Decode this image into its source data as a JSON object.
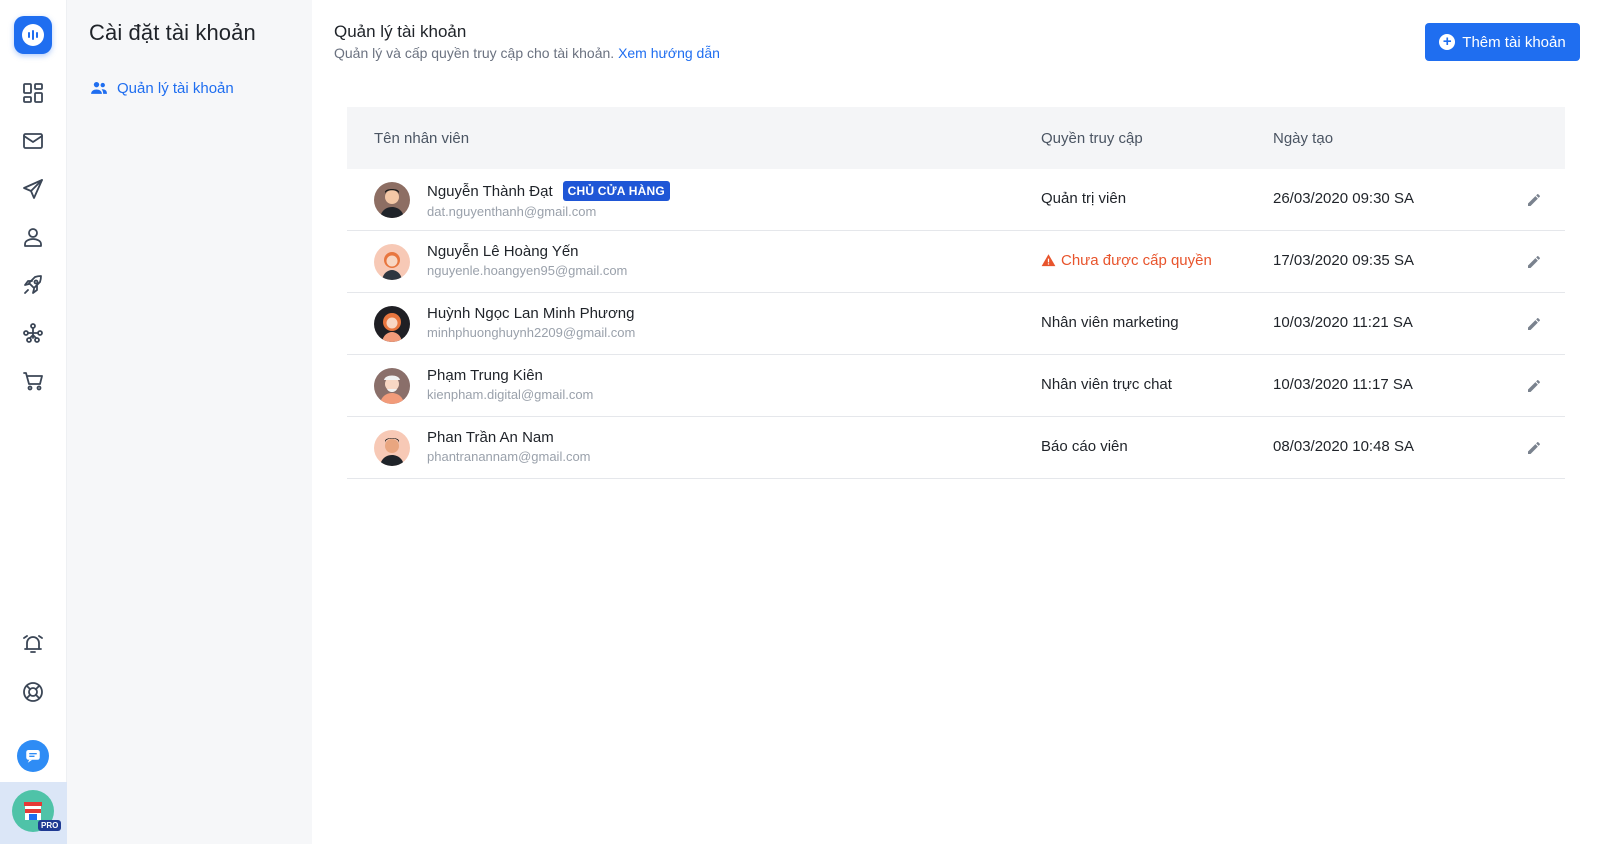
{
  "rail": {
    "icons": [
      "dashboard-icon",
      "mail-icon",
      "send-icon",
      "user-icon",
      "rocket-icon",
      "network-icon",
      "cart-icon",
      "alarm-icon",
      "support-icon",
      "chat-icon"
    ],
    "store_badge": "PRO"
  },
  "sidebar": {
    "title": "Cài đặt tài khoản",
    "items": [
      {
        "label": "Quản lý tài khoản",
        "icon": "people-icon",
        "active": true
      }
    ]
  },
  "header": {
    "title": "Quản lý tài khoản",
    "subtitle": "Quản lý và cấp quyền truy cập cho tài khoản.",
    "guide_link": "Xem hướng dẫn",
    "add_button": "Thêm tài khoản"
  },
  "table": {
    "columns": [
      "Tên nhân viên",
      "Quyền truy cập",
      "Ngày tạo"
    ],
    "rows": [
      {
        "name": "Nguyễn Thành Đạt",
        "badge": "CHỦ CỬA HÀNG",
        "email": "dat.nguyenthanh@gmail.com",
        "role": "Quản trị viên",
        "warn": false,
        "created": "26/03/2020 09:30 SA"
      },
      {
        "name": "Nguyễn Lê Hoàng Yến",
        "badge": "",
        "email": "nguyenle.hoangyen95@gmail.com",
        "role": "Chưa được cấp quyền",
        "warn": true,
        "created": "17/03/2020 09:35 SA"
      },
      {
        "name": "Huỳnh Ngọc Lan Minh Phương",
        "badge": "",
        "email": "minhphuonghuynh2209@gmail.com",
        "role": "Nhân viên marketing",
        "warn": false,
        "created": "10/03/2020 11:21 SA"
      },
      {
        "name": "Phạm Trung Kiên",
        "badge": "",
        "email": "kienpham.digital@gmail.com",
        "role": "Nhân viên trực chat",
        "warn": false,
        "created": "10/03/2020 11:17 SA"
      },
      {
        "name": "Phan Trần An Nam",
        "badge": "",
        "email": "phantranannam@gmail.com",
        "role": "Báo cáo viên",
        "warn": false,
        "created": "08/03/2020 10:48 SA"
      }
    ]
  },
  "colors": {
    "primary": "#1f6ef0",
    "warning": "#e8542c",
    "badge": "#1f56d6"
  }
}
